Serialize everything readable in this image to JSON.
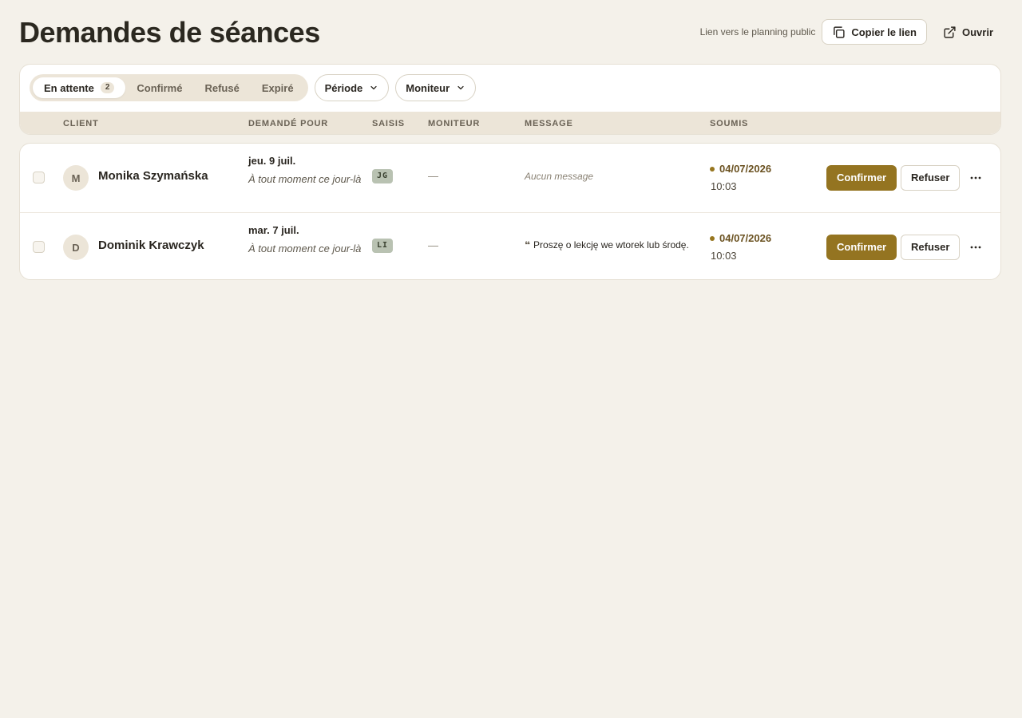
{
  "header": {
    "title": "Demandes de séances",
    "public_link_label": "Lien vers le planning public",
    "copy_link_label": "Copier le lien",
    "open_label": "Ouvrir"
  },
  "filters": {
    "tabs": [
      {
        "label": "En attente",
        "count": "2",
        "active": true
      },
      {
        "label": "Confirmé"
      },
      {
        "label": "Refusé"
      },
      {
        "label": "Expiré"
      }
    ],
    "period_label": "Période",
    "instructor_label": "Moniteur"
  },
  "table": {
    "columns": {
      "client": "CLIENT",
      "requested_for": "DEMANDÉ POUR",
      "entered_by": "SAISIS",
      "instructor": "MONITEUR",
      "message": "MESSAGE",
      "submitted": "SOUMIS"
    },
    "rows": [
      {
        "avatar": "M",
        "name": "Monika Szymańska",
        "date": "jeu. 9 juil.",
        "time_note": "À tout moment ce jour-là",
        "entered_by": "JG",
        "instructor": "—",
        "message": "Aucun message",
        "has_message": false,
        "submitted_date": "04/07/2026",
        "submitted_time": "10:03",
        "confirm_label": "Confirmer",
        "refuse_label": "Refuser"
      },
      {
        "avatar": "D",
        "name": "Dominik Krawczyk",
        "date": "mar. 7 juil.",
        "time_note": "À tout moment ce jour-là",
        "entered_by": "LI",
        "instructor": "—",
        "message": "Proszę o lekcję we wtorek lub środę.",
        "has_message": true,
        "submitted_date": "04/07/2026",
        "submitted_time": "10:03",
        "confirm_label": "Confirmer",
        "refuse_label": "Refuser"
      }
    ]
  },
  "colors": {
    "accent": "#947421",
    "background": "#f4f1ea",
    "header_band": "#ece5d8"
  },
  "icons": {
    "copy": "copy-icon",
    "external": "external-link-icon",
    "chevron": "chevron-down-icon",
    "more": "more-horizontal-icon",
    "quote": "quote-icon"
  }
}
